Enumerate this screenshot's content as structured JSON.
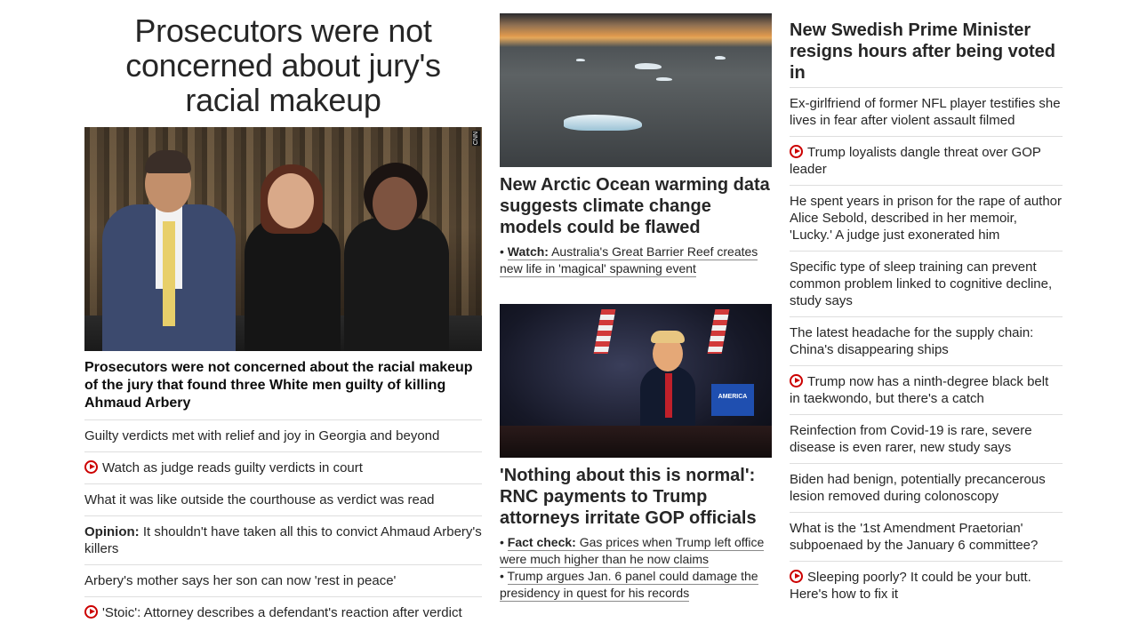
{
  "left": {
    "big_headline": "Prosecutors were not concerned about jury's racial makeup",
    "image_watermark": "CNN",
    "lead_caption": "Prosecutors were not concerned about the racial makeup of the jury that found three White men guilty of killing Ahmaud Arbery",
    "items": [
      {
        "prefix": "",
        "text": "Guilty verdicts met with relief and joy in Georgia and beyond",
        "video": false
      },
      {
        "prefix": "",
        "text": "Watch as judge reads guilty verdicts in court",
        "video": true
      },
      {
        "prefix": "",
        "text": "What it was like outside the courthouse as verdict was read",
        "video": false
      },
      {
        "prefix": "Opinion:",
        "text": " It shouldn't have taken all this to convict Ahmaud Arbery's killers",
        "video": false
      },
      {
        "prefix": "",
        "text": "Arbery's mother says her son can now 'rest in peace'",
        "video": false
      },
      {
        "prefix": "",
        "text": "'Stoic': Attorney describes a defendant's reaction after verdict",
        "video": true
      }
    ]
  },
  "middle": {
    "story1": {
      "headline": "New Arctic Ocean warming data suggests climate change models could be flawed",
      "sub_label": "Watch:",
      "sub_text": "Australia's Great Barrier Reef creates new life in 'magical' spawning event"
    },
    "story2": {
      "image_sign": "AMERICA",
      "headline": "'Nothing about this is normal': RNC payments to Trump attorneys irritate GOP officials",
      "sub1_label": "Fact check:",
      "sub1_text": "Gas prices when Trump left office were much higher than he now claims",
      "sub2_text": "Trump argues Jan. 6 panel could damage the presidency in quest for his records"
    }
  },
  "right": {
    "headline": "New Swedish Prime Minister resigns hours after being voted in",
    "items": [
      {
        "text": "Ex-girlfriend of former NFL player testifies she lives in fear after violent assault filmed",
        "video": false
      },
      {
        "text": "Trump loyalists dangle threat over GOP leader",
        "video": true
      },
      {
        "text": "He spent years in prison for the rape of author Alice Sebold, described in her memoir, 'Lucky.' A judge just exonerated him",
        "video": false
      },
      {
        "text": "Specific type of sleep training can prevent common problem linked to cognitive decline, study says",
        "video": false
      },
      {
        "text": "The latest headache for the supply chain: China's disappearing ships",
        "video": false
      },
      {
        "text": "Trump now has a ninth-degree black belt in taekwondo, but there's a catch",
        "video": true
      },
      {
        "text": "Reinfection from Covid-19 is rare, severe disease is even rarer, new study says",
        "video": false
      },
      {
        "text": "Biden had benign, potentially precancerous lesion removed during colonoscopy",
        "video": false
      },
      {
        "text": "What is the '1st Amendment Praetorian' subpoenaed by the January 6 committee?",
        "video": false
      },
      {
        "text": "Sleeping poorly? It could be your butt. Here's how to fix it",
        "video": true
      }
    ]
  },
  "colors": {
    "accent_red": "#cc0000",
    "text": "#262626",
    "divider": "#dedede"
  }
}
